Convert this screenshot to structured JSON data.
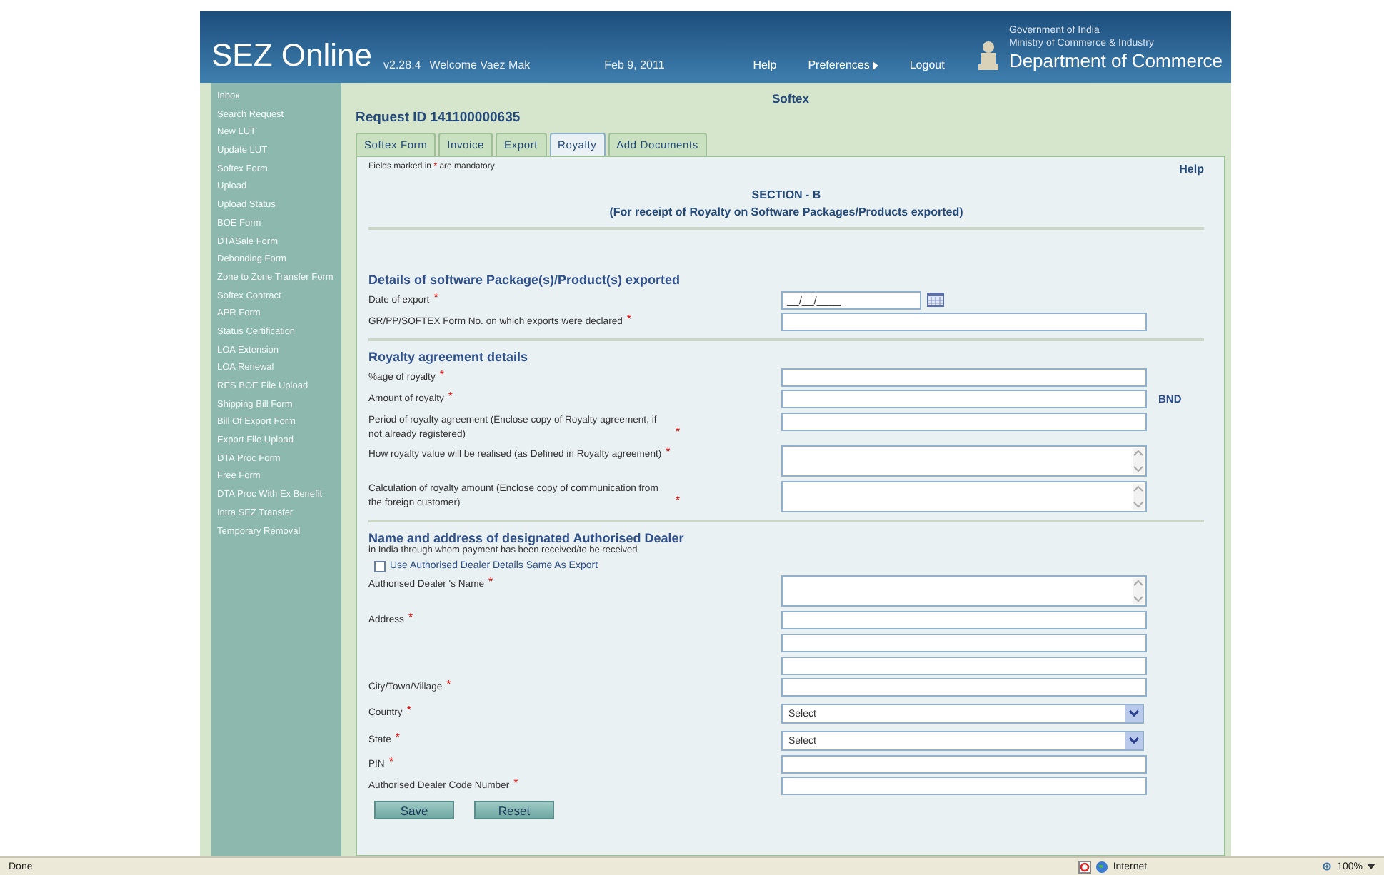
{
  "header": {
    "logo": "SEZ Online",
    "version": "v2.28.4",
    "welcome": "Welcome Vaez Mak",
    "date": "Feb 9, 2011",
    "links": [
      {
        "label": "Help",
        "kind": "link"
      },
      {
        "label": "Preferences",
        "kind": "menu"
      },
      {
        "label": "Logout",
        "kind": "link"
      }
    ],
    "org": [
      "Government of India",
      "Ministry of Commerce & Industry",
      "Department of Commerce"
    ]
  },
  "sidebar": {
    "items": [
      "Inbox",
      "Search Request",
      "New LUT",
      "Update LUT",
      "Softex Form",
      "Upload",
      "Upload Status",
      "BOE Form",
      "DTASale Form",
      "Debonding Form",
      "Zone to Zone Transfer Form",
      "Softex Contract",
      "APR Form",
      "Status Certification",
      "LOA Extension",
      "LOA Renewal",
      "RES BOE File Upload",
      "Shipping Bill Form",
      "Bill Of Export Form",
      "Export File Upload",
      "DTA Proc Form",
      "Free Form",
      "DTA Proc With Ex Benefit",
      "Intra SEZ Transfer",
      "Temporary Removal"
    ]
  },
  "page_title": "Softex",
  "request_id": "Request ID 141100000635",
  "tabs": [
    {
      "label": "Softex Form",
      "selected": false
    },
    {
      "label": "Invoice",
      "selected": false
    },
    {
      "label": "Export",
      "selected": false
    },
    {
      "label": "Royalty",
      "selected": true
    },
    {
      "label": "Add Documents",
      "selected": false
    }
  ],
  "form": {
    "mandatory_note": {
      "before": "Fields marked in",
      "mark": "*",
      "after": "are mandatory"
    },
    "help": "Help",
    "section_heading": "SECTION - B",
    "section_subheading": "(For receipt of Royalty on Software Packages/Products exported)",
    "sections": [
      {
        "title": "Details of software Package(s)/Product(s) exported",
        "rows": [
          {
            "label": "Date of export",
            "required": true,
            "inputs": [
              {
                "kind": "date",
                "value": "__/__/____"
              }
            ]
          },
          {
            "label": "GR/PP/SOFTEX Form No. on which exports were declared",
            "required": true,
            "inputs": [
              {
                "kind": "text"
              }
            ]
          }
        ]
      },
      {
        "title": "Royalty agreement details",
        "rows": [
          {
            "label": "%age of royalty",
            "required": true,
            "inputs": [
              {
                "kind": "text"
              }
            ]
          },
          {
            "label": "Amount of royalty",
            "required": true,
            "inputs": [
              {
                "kind": "text"
              }
            ],
            "suffix": "BND"
          },
          {
            "label": "Period of royalty agreement (Enclose copy of Royalty agreement, if not already registered)",
            "required": true,
            "inputs": [
              {
                "kind": "text"
              }
            ]
          },
          {
            "label": "How royalty value will be realised (as Defined in Royalty agreement)",
            "required": true,
            "inputs": [
              {
                "kind": "textarea"
              }
            ]
          },
          {
            "label": "Calculation of royalty amount (Enclose copy of communication from the foreign customer)",
            "required": true,
            "inputs": [
              {
                "kind": "textarea"
              }
            ]
          }
        ]
      },
      {
        "title": "Name and address of designated Authorised Dealer",
        "subtitle": "in India through whom payment has been received/to be received",
        "checkbox": {
          "label": "Use Authorised Dealer Details Same As Export",
          "checked": false
        },
        "rows": [
          {
            "label": "Authorised Dealer 's Name",
            "required": true,
            "inputs": [
              {
                "kind": "textarea"
              }
            ]
          },
          {
            "label": "Address",
            "required": true,
            "inputs": [
              {
                "kind": "text"
              },
              {
                "kind": "text"
              },
              {
                "kind": "text"
              }
            ]
          },
          {
            "label": "City/Town/Village",
            "required": true,
            "inputs": [
              {
                "kind": "text"
              }
            ]
          },
          {
            "label": "Country",
            "required": true,
            "inputs": [
              {
                "kind": "select",
                "value": "Select"
              }
            ]
          },
          {
            "label": "State",
            "required": true,
            "inputs": [
              {
                "kind": "select",
                "value": "Select"
              }
            ]
          },
          {
            "label": "PIN",
            "required": true,
            "inputs": [
              {
                "kind": "text"
              }
            ]
          },
          {
            "label": "Authorised Dealer Code Number",
            "required": true,
            "inputs": [
              {
                "kind": "text"
              }
            ]
          }
        ]
      }
    ],
    "buttons": [
      "Save",
      "Reset"
    ]
  },
  "status_bar": {
    "status": "Done",
    "zone": "Internet",
    "zoom": "100%"
  }
}
